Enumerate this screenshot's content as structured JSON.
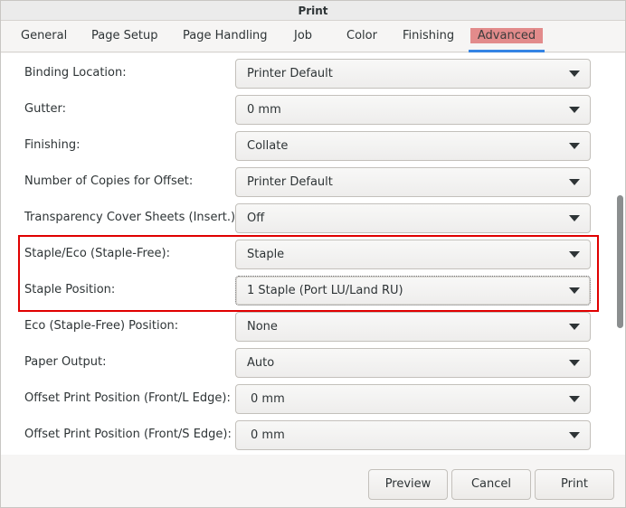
{
  "window": {
    "title": "Print"
  },
  "tabs": [
    {
      "label": "General"
    },
    {
      "label": "Page Setup"
    },
    {
      "label": "Page Handling"
    },
    {
      "label": "Job"
    },
    {
      "label": "Color"
    },
    {
      "label": "Finishing"
    },
    {
      "label": "Advanced",
      "active": true
    }
  ],
  "options": [
    {
      "label": "Binding Location:",
      "value": "Printer Default"
    },
    {
      "label": "Gutter:",
      "value": "0 mm"
    },
    {
      "label": "Finishing:",
      "value": "Collate"
    },
    {
      "label": "Number of Copies for Offset:",
      "value": "Printer Default"
    },
    {
      "label": "Transparency Cover Sheets (Insert.):",
      "value": "Off"
    },
    {
      "label": "Staple/Eco (Staple-Free):",
      "value": "Staple"
    },
    {
      "label": "Staple Position:",
      "value": "1 Staple (Port LU/Land RU)"
    },
    {
      "label": "Eco (Staple-Free) Position:",
      "value": "None"
    },
    {
      "label": "Paper Output:",
      "value": "Auto"
    },
    {
      "label": "Offset Print Position (Front/L Edge):",
      "value": "0 mm"
    },
    {
      "label": "Offset Print Position (Front/S Edge):",
      "value": "0 mm"
    }
  ],
  "buttons": {
    "preview": "Preview",
    "cancel": "Cancel",
    "print": "Print"
  },
  "colors": {
    "highlight": "#e00000",
    "active_tab_bg": "#e28b8b",
    "active_tab_underline": "#3584e4"
  }
}
